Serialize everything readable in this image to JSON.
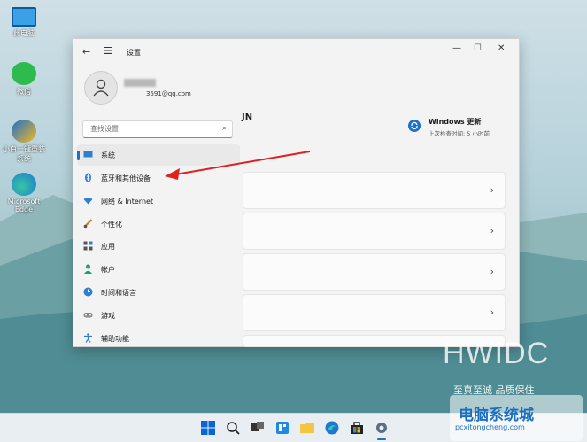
{
  "desktop": {
    "icons": [
      {
        "label": "此电脑",
        "name": "this-pc-icon"
      },
      {
        "label": "微信",
        "name": "wechat-icon"
      },
      {
        "label": "小白一键重装\n系统",
        "name": "reinstall-tool-icon"
      },
      {
        "label": "Microsoft\nEdge",
        "name": "edge-icon"
      }
    ]
  },
  "window": {
    "title": "设置",
    "profile": {
      "email": "3591@qq.com"
    },
    "search": {
      "placeholder": "查找设置"
    },
    "nav": [
      {
        "label": "系统",
        "icon": "monitor-icon",
        "active": true
      },
      {
        "label": "蓝牙和其他设备",
        "icon": "bluetooth-icon"
      },
      {
        "label": "网络 & Internet",
        "icon": "wifi-icon"
      },
      {
        "label": "个性化",
        "icon": "brush-icon"
      },
      {
        "label": "应用",
        "icon": "apps-icon"
      },
      {
        "label": "帐户",
        "icon": "person-icon"
      },
      {
        "label": "时间和语言",
        "icon": "globe-clock-icon"
      },
      {
        "label": "游戏",
        "icon": "gamepad-icon"
      },
      {
        "label": "辅助功能",
        "icon": "accessibility-icon"
      }
    ],
    "content": {
      "heading": "JN",
      "update": {
        "title": "Windows 更新",
        "subtitle": "上次检查时间: 5 小时前"
      }
    }
  },
  "watermark": {
    "brand": "HWIDC",
    "slogan": "至真至诚 品质保住",
    "site_cn": "电脑系统城",
    "site_url": "pcxitongcheng.com"
  },
  "colors": {
    "accent": "#1a73c8",
    "arrow": "#e02020"
  }
}
